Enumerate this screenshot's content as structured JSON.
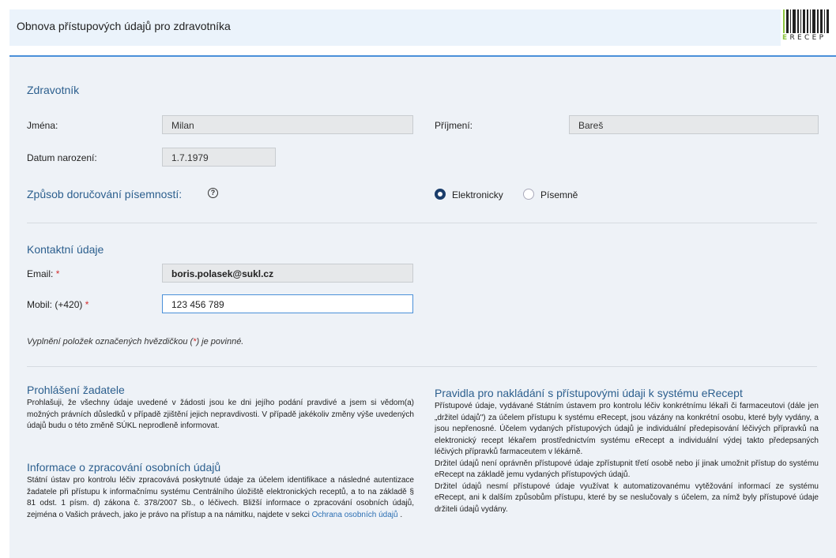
{
  "header": {
    "title": "Obnova přístupových údajů pro zdravotníka",
    "logo_text": "ERECEP"
  },
  "zdravotnik": {
    "section_title": "Zdravotník",
    "jmena_label": "Jména:",
    "jmena_value": "Milan",
    "prijmeni_label": "Příjmení:",
    "prijmeni_value": "Bareš",
    "datum_label": "Datum narození:",
    "datum_value": "1.7.1979",
    "doruceni_label": "Způsob doručování písemností:",
    "help_icon": "?",
    "radio_electronic": "Elektronicky",
    "radio_paper": "Písemně",
    "selected": "Elektronicky"
  },
  "kontakt": {
    "section_title": "Kontaktní údaje",
    "email_label": "Email:",
    "email_value": "boris.polasek@sukl.cz",
    "mobil_label": "Mobil: (+420)",
    "mobil_value": "123 456 789",
    "required_mark": "*",
    "note_before": "Vyplnění položek označených hvězdičkou (",
    "note_mark": "*",
    "note_after": ") je povinné."
  },
  "prohlaseni": {
    "title": "Prohlášení žadatele",
    "text": "Prohlašuji, že všechny údaje uvedené v žádosti jsou ke dni jejího podání pravdivé a jsem si vědom(a) možných právních důsledků v případě zjištění jejich nepravdivosti. V případě jakékoliv změny výše uvedených údajů budu o této změně SÚKL neprodleně informovat."
  },
  "informace": {
    "title": "Informace o zpracování osobních údajů",
    "text": "Státní ústav pro kontrolu léčiv zpracovává poskytnuté údaje za účelem identifikace a následné autentizace žadatele při přístupu k informačnímu systému Centrálního úložiště elektronických receptů, a to na základě § 81 odst. 1 písm. d) zákona č. 378/2007 Sb., o léčivech. Bližší informace o zpracování osobních údajů, zejména o Vašich právech, jako je právo na přístup a na námitku, najdete v sekci ",
    "link": "Ochrana osobních údajů",
    "text_end": " ."
  },
  "pravidla": {
    "title": "Pravidla pro nakládání s přístupovými údaji k systému eRecept",
    "p1": "Přístupové údaje, vydávané Státním ústavem pro kontrolu léčiv konkrétnímu lékaři či farmaceutovi (dále jen „držitel údajů\") za účelem přístupu k systému eRecept, jsou vázány na konkrétní osobu, které byly vydány, a jsou nepřenosné. Účelem vydaných přístupových údajů je individuální předepisování léčivých přípravků na elektronický recept lékařem prostřednictvím systému eRecept a individuální výdej takto předepsaných léčivých přípravků farmaceutem v lékárně.",
    "p2": "Držitel údajů není oprávněn přístupové údaje zpřístupnit třetí osobě nebo jí jinak umožnit přístup do systému eRecept na základě jemu vydaných přístupových údajů.",
    "p3": "Držitel údajů nesmí přístupové údaje využívat k automatizovanému vytěžování informací ze systému eRecept, ani k dalším způsobům přístupu, které by se neslučovaly s účelem, za nímž byly přístupové údaje držiteli údajů vydány."
  }
}
